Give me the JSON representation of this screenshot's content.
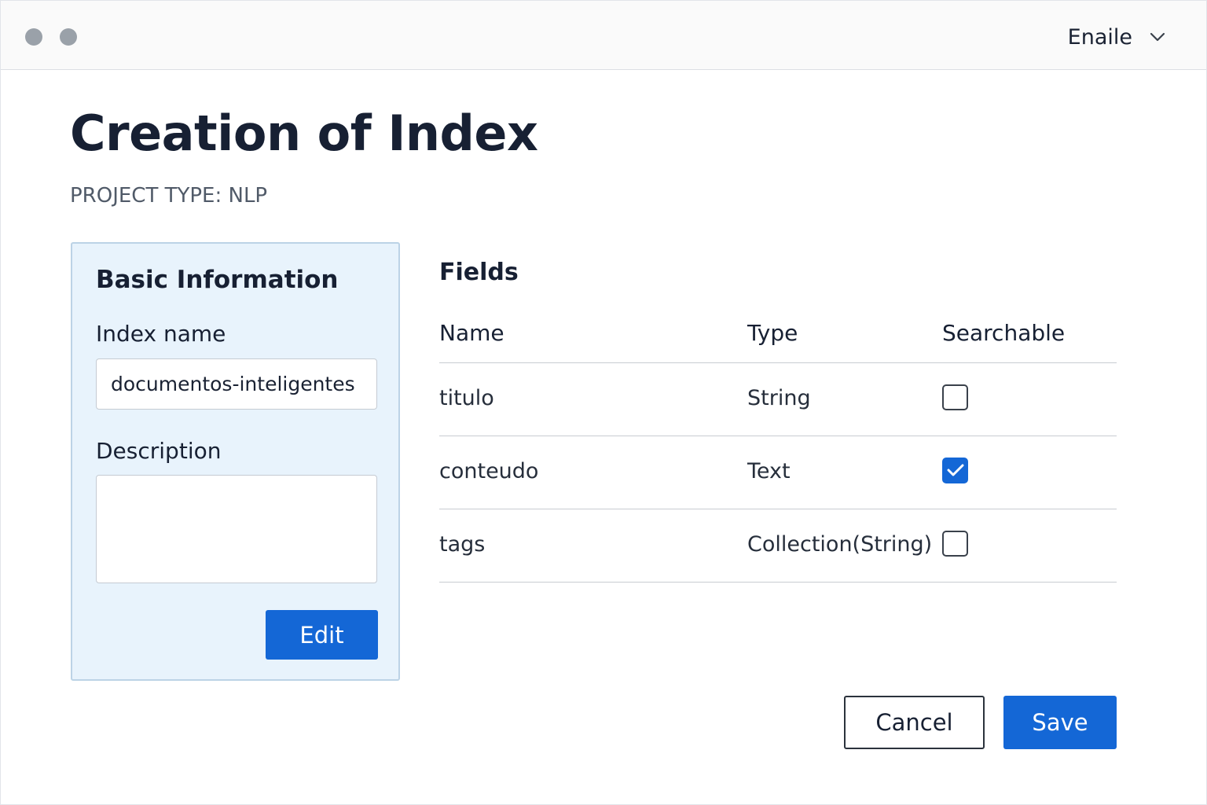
{
  "window": {
    "user_menu": {
      "name": "Enaile",
      "icon": "chevron-down-icon"
    }
  },
  "header": {
    "title": "Creation of Index",
    "project_type": "PROJECT TYPE: NLP"
  },
  "basic_info": {
    "title": "Basic Information",
    "index_name_label": "Index name",
    "index_name_value": "documentos-inteligentes",
    "description_label": "Description",
    "description_value": "",
    "edit_label": "Edit"
  },
  "fields": {
    "title": "Fields",
    "columns": [
      "Name",
      "Type",
      "Searchable"
    ],
    "rows": [
      {
        "name": "titulo",
        "type": "String",
        "searchable": false
      },
      {
        "name": "conteudo",
        "type": "Text",
        "searchable": true
      },
      {
        "name": "tags",
        "type": "Collection(String)",
        "searchable": false
      }
    ]
  },
  "actions": {
    "cancel_label": "Cancel",
    "save_label": "Save"
  },
  "colors": {
    "accent": "#1467d6",
    "card_background": "#e8f3fc"
  }
}
